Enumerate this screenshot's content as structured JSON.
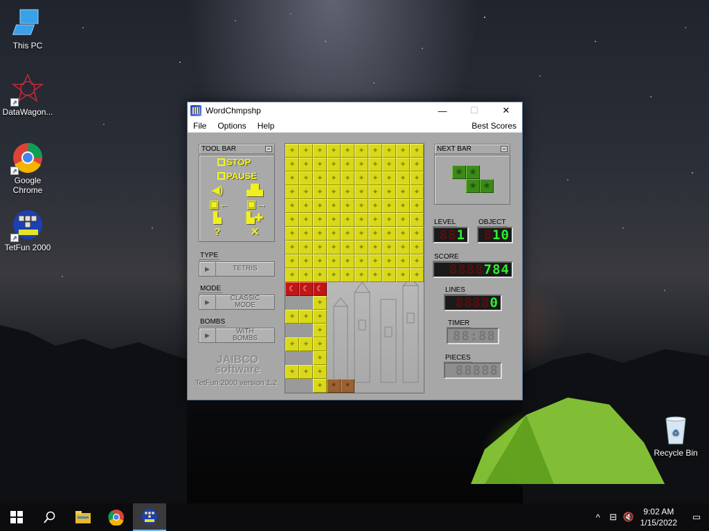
{
  "desktop": {
    "icons": [
      {
        "label": "This PC",
        "icon": "computer-icon"
      },
      {
        "label": "DataWagon...",
        "icon": "datawagon-icon"
      },
      {
        "label": "Google Chrome",
        "icon": "chrome-icon"
      },
      {
        "label": "TetFun 2000",
        "icon": "tetfun-icon"
      }
    ],
    "recycle_bin": {
      "label": "Recycle Bin",
      "icon": "recycle-bin-icon"
    }
  },
  "window": {
    "title": "WordChmpshp",
    "controls": {
      "minimize": "—",
      "maximize": "☐",
      "close": "✕"
    },
    "menu": [
      "File",
      "Options",
      "Help"
    ],
    "menu_right": "Best Scores"
  },
  "toolbar": {
    "title": "TOOL BAR",
    "stop_label": "STOP",
    "pause_label": "PAUSE",
    "icons": [
      "sound-icon",
      "block-up-icon",
      "save-left-icon",
      "save-right-icon",
      "load-icon",
      "load-alt-icon",
      "help-icon",
      "exit-icon"
    ]
  },
  "options": {
    "type": {
      "label": "TYPE",
      "value": "TETRIS"
    },
    "mode": {
      "label": "MODE",
      "value_line1": "CLASSIC",
      "value_line2": "MODE"
    },
    "bombs": {
      "label": "BOMBS",
      "value_line1": "WITH",
      "value_line2": "BOMBS"
    }
  },
  "branding": {
    "company_line1": "JAIBCO",
    "company_line2": "software",
    "version": "TetFun 2000 version 1.2"
  },
  "next_bar": {
    "title": "NEXT BAR",
    "piece": "S",
    "color": "#3d8a1a"
  },
  "stats": {
    "level": {
      "label": "LEVEL",
      "off": "88",
      "on": "1"
    },
    "object": {
      "label": "OBJECT",
      "off": "8",
      "on": "10"
    },
    "score": {
      "label": "SCORE",
      "off": "8888",
      "on": "784"
    },
    "lines": {
      "label": "LINES",
      "off": "8888",
      "on": "0"
    },
    "timer": {
      "label": "TIMER",
      "off": "88:88",
      "on": ""
    },
    "pieces": {
      "label": "PIECES",
      "off": "88888",
      "on": ""
    }
  },
  "board": {
    "cols": 10,
    "rows": 18,
    "colors": {
      "y": "#d9d91a",
      "r": "#c41414",
      "b": "#9a6230"
    },
    "grid": [
      "yyyyyyyyyy",
      "yyyyyyyyyy",
      "yyyyyyyyyy",
      "yyyyyyyyyy",
      "yyyyyyyyyy",
      "yyyyyyyyyy",
      "yyyyyyyyyy",
      "yyyyyyyyyy",
      "yyyyyyyyyy",
      "yyyyyyyyyy",
      "rrr.......",
      "..y.......",
      "yyy.......",
      "..y.......",
      "yyy.......",
      "..y.......",
      "yyy.......",
      "..ybb.....",
      "yyybb....."
    ]
  },
  "taskbar": {
    "items": [
      "start-icon",
      "search-icon",
      "file-explorer-icon",
      "chrome-icon",
      "tetfun-icon"
    ],
    "time": "9:02 AM",
    "date": "1/15/2022"
  }
}
